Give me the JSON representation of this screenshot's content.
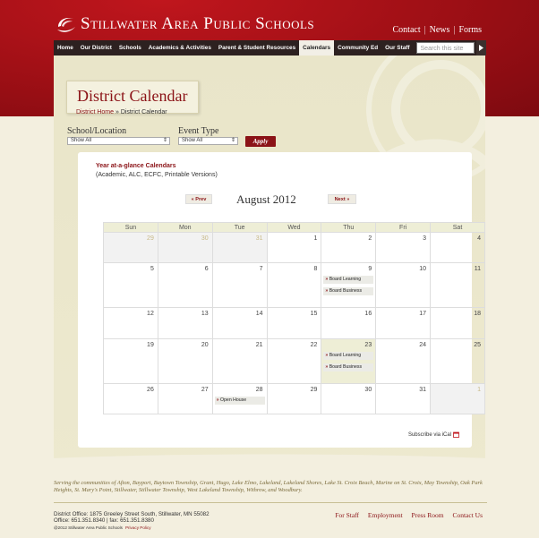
{
  "header": {
    "logo_text": "Stillwater Area Public Schools",
    "top_links": [
      "Contact",
      "News",
      "Forms"
    ],
    "nav": [
      "Home",
      "Our District",
      "Schools",
      "Academics & Activities",
      "Parent & Student Resources",
      "Calendars",
      "Community Ed",
      "Our Staff"
    ],
    "active_nav": "Calendars",
    "search_placeholder": "Search this site"
  },
  "page": {
    "title": "District Calendar",
    "breadcrumb_home": "District Home",
    "breadcrumb_sep": " » ",
    "breadcrumb_current": "District Calendar"
  },
  "filters": {
    "school_label": "School/Location",
    "school_value": "Show All",
    "event_label": "Event Type",
    "event_value": "Show All",
    "apply_label": "Apply"
  },
  "calendar": {
    "yag_title": "Year at-a-glance Calendars",
    "yag_sub": "(Academic, ALC, ECFC, Printable Versions)",
    "prev_label": "« Prev",
    "next_label": "Next »",
    "month_title": "August 2012",
    "weekdays": [
      "Sun",
      "Mon",
      "Tue",
      "Wed",
      "Thu",
      "Fri",
      "Sat"
    ],
    "weeks": [
      [
        {
          "d": "29",
          "other": true
        },
        {
          "d": "30",
          "other": true
        },
        {
          "d": "31",
          "other": true
        },
        {
          "d": "1"
        },
        {
          "d": "2"
        },
        {
          "d": "3"
        },
        {
          "d": "4"
        }
      ],
      [
        {
          "d": "5"
        },
        {
          "d": "6"
        },
        {
          "d": "7"
        },
        {
          "d": "8"
        },
        {
          "d": "9",
          "events": [
            "Board Learning",
            "Board Business"
          ]
        },
        {
          "d": "10"
        },
        {
          "d": "11"
        }
      ],
      [
        {
          "d": "12"
        },
        {
          "d": "13"
        },
        {
          "d": "14"
        },
        {
          "d": "15"
        },
        {
          "d": "16"
        },
        {
          "d": "17"
        },
        {
          "d": "18"
        }
      ],
      [
        {
          "d": "19"
        },
        {
          "d": "20"
        },
        {
          "d": "21"
        },
        {
          "d": "22"
        },
        {
          "d": "23",
          "today": true,
          "events": [
            "Board Learning",
            "Board Business"
          ]
        },
        {
          "d": "24"
        },
        {
          "d": "25"
        }
      ],
      [
        {
          "d": "26"
        },
        {
          "d": "27"
        },
        {
          "d": "28",
          "events": [
            "Open House"
          ]
        },
        {
          "d": "29"
        },
        {
          "d": "30"
        },
        {
          "d": "31"
        },
        {
          "d": "1",
          "other": true
        }
      ]
    ],
    "ical_label": "Subscribe via iCal"
  },
  "footer": {
    "serving": "Serving the communities of Afton, Bayport, Baytown Township, Grant, Hugo, Lake Elmo, Lakeland, Lakeland Shores, Lake St. Croix Beach, Marine on St. Croix, May Township, Oak Park Heights, St. Mary's Point, Stillwater, Stillwater Township, West Lakeland Township, Withrow, and Woodbury.",
    "address": "District Office:  1875 Greeley Street South, Stillwater, MN 55082",
    "phone": "Office:  651.351.8340 | fax:  651.351.8380",
    "copyright": "@2012   Stillwater Area Public Schools",
    "privacy": "Privacy Policy",
    "links": [
      "For Staff",
      "Employment",
      "Press Room",
      "Contact Us"
    ]
  },
  "colors": {
    "brand_red": "#8b1317",
    "header_red": "#9d0f15",
    "nav_dark": "#2d2120",
    "today_bg": "#eeeed6"
  }
}
